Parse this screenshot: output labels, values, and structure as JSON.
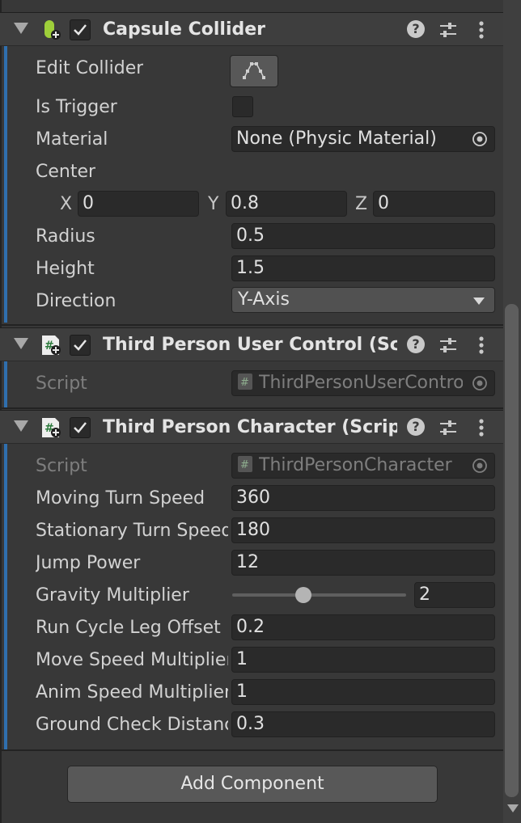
{
  "capsule": {
    "title": "Capsule Collider",
    "labels": {
      "edit_collider": "Edit Collider",
      "is_trigger": "Is Trigger",
      "material": "Material",
      "center": "Center",
      "radius": "Radius",
      "height": "Height",
      "direction": "Direction"
    },
    "material_value": "None (Physic Material)",
    "center": {
      "x_label": "X",
      "x": "0",
      "y_label": "Y",
      "y": "0.8",
      "z_label": "Z",
      "z": "0"
    },
    "radius": "0.5",
    "height": "1.5",
    "direction": "Y-Axis",
    "is_trigger_checked": false
  },
  "user_control": {
    "title": "Third Person User Control (Script)",
    "script_label": "Script",
    "script_value": "ThirdPersonUserControl"
  },
  "character": {
    "title": "Third Person Character (Script)",
    "script_label": "Script",
    "script_value": "ThirdPersonCharacter",
    "fields": [
      {
        "label": "Moving Turn Speed",
        "value": "360"
      },
      {
        "label": "Stationary Turn Speed",
        "value": "180"
      },
      {
        "label": "Jump Power",
        "value": "12"
      },
      {
        "label": "Gravity Multiplier",
        "value": "2"
      },
      {
        "label": "Run Cycle Leg Offset",
        "value": "0.2"
      },
      {
        "label": "Move Speed Multiplier",
        "value": "1"
      },
      {
        "label": "Anim Speed Multiplier",
        "value": "1"
      },
      {
        "label": "Ground Check Distance",
        "value": "0.3"
      }
    ],
    "gravity_slider_fraction": 0.4
  },
  "add_component_label": "Add Component",
  "header_icons": [
    "help-icon",
    "preset-icon",
    "kebab-menu-icon"
  ],
  "colors": {
    "accent": "#2f6fae",
    "collider_icon": "#9ecf3a",
    "script_icon_hash": "#2c7a3c"
  }
}
